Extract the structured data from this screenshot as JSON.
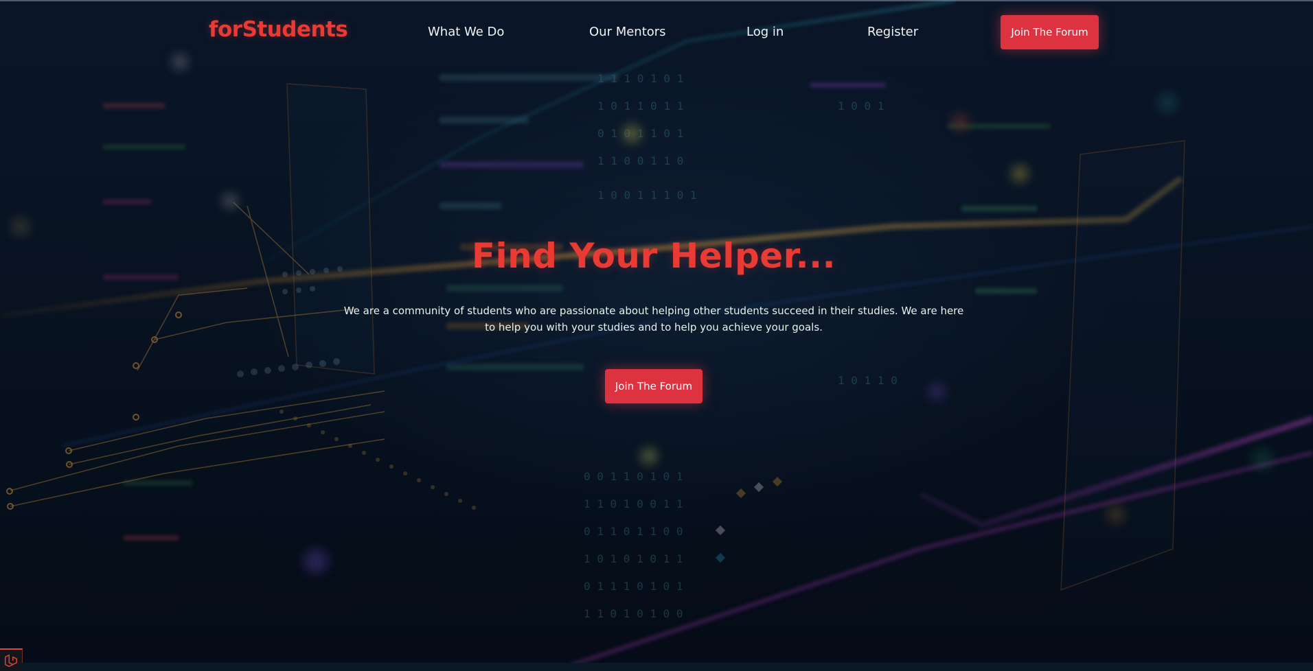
{
  "brand": {
    "name": "forStudents"
  },
  "nav": {
    "what_we_do": "What We Do",
    "our_mentors": "Our Mentors",
    "log_in": "Log in",
    "register": "Register",
    "join_button": "Join The Forum"
  },
  "hero": {
    "title": "Find Your Helper...",
    "description": "We are a community of students who are passionate about helping other students succeed in their studies. We are here to help you with your studies and to help you achieve your goals.",
    "cta_label": "Join The Forum"
  },
  "icons": {
    "corner_logo": "laravel-icon"
  },
  "colors": {
    "brand_red": "#e93a34",
    "button_red": "#dd3341",
    "background": "#07111f",
    "text_light": "#f2f4f7"
  }
}
